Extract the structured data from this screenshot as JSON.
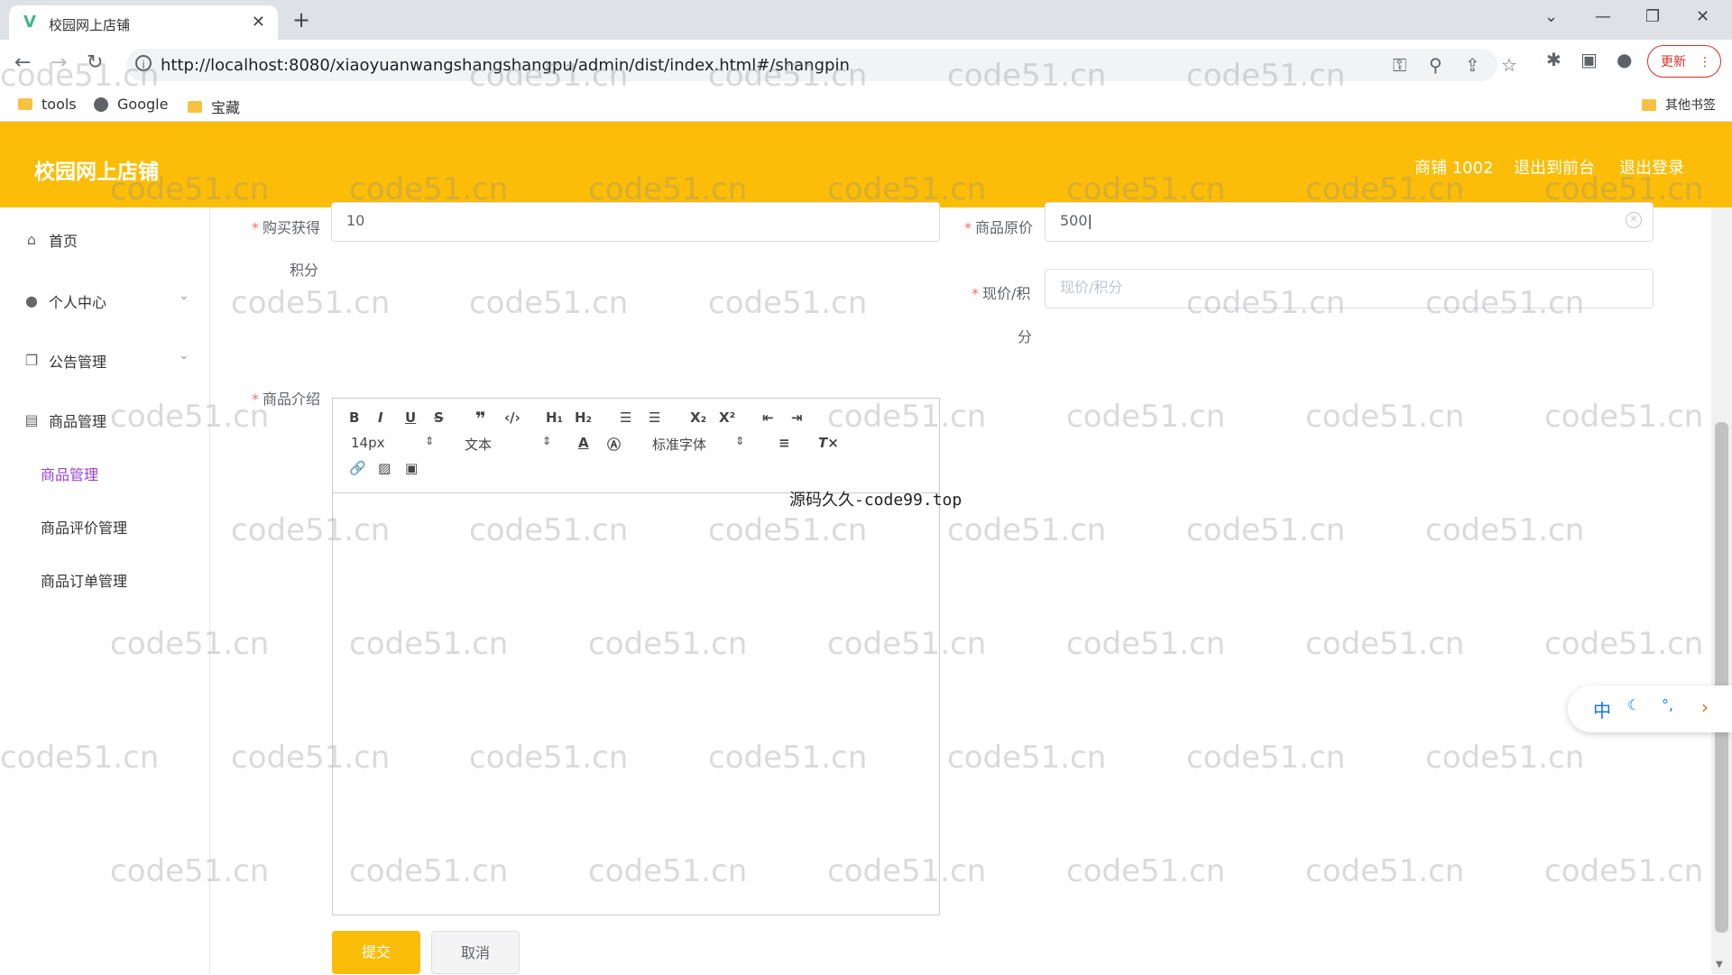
{
  "browser": {
    "tab_title": "校园网上店铺",
    "tab_favicon": "V",
    "url": "http://localhost:8080/xiaoyuanwangshangshangpu/admin/dist/index.html#/shangpin",
    "update_label": "更新",
    "bookmarks": [
      "tools",
      "Google",
      "宝藏"
    ],
    "other_bookmarks": "其他书签"
  },
  "header": {
    "brand": "校园网上店铺",
    "user": "商铺 1002",
    "to_front": "退出到前台",
    "logout": "退出登录",
    "color": "#fbbd08"
  },
  "sidebar": {
    "items": [
      {
        "label": "首页",
        "icon": "home-icon"
      },
      {
        "label": "个人中心",
        "icon": "user-icon"
      },
      {
        "label": "公告管理",
        "icon": "copy-icon"
      },
      {
        "label": "商品管理",
        "icon": "shop-icon"
      }
    ],
    "sub_items": [
      {
        "label": "商品管理",
        "active": true
      },
      {
        "label": "商品评价管理",
        "active": false
      },
      {
        "label": "商品订单管理",
        "active": false
      }
    ]
  },
  "form": {
    "points_label_1": "购买获得",
    "points_label_2": "积分",
    "points_value": "10",
    "price_label": "商品原价",
    "price_value": "500",
    "now_label_1": "现价/积",
    "now_label_2": "分",
    "now_placeholder": "现价/积分",
    "intro_label": "商品介绍",
    "submit": "提交",
    "cancel": "取消"
  },
  "editor": {
    "font_size": "14px",
    "block_type": "文本",
    "font_family": "标准字体",
    "overlay_text": "源码久久-code99.top"
  },
  "ime": {
    "lang": "中"
  },
  "watermark": "code51.cn"
}
